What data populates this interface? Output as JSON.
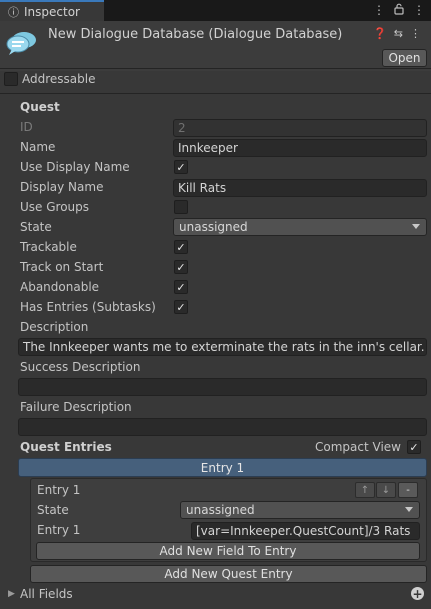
{
  "tab": {
    "icon": "info-icon",
    "label": "Inspector"
  },
  "header": {
    "title": "New Dialogue Database (Dialogue Database)",
    "open_label": "Open"
  },
  "addressable": {
    "label": "Addressable",
    "checked": false
  },
  "quest": {
    "heading": "Quest",
    "id": {
      "label": "ID",
      "value": "2"
    },
    "name": {
      "label": "Name",
      "value": "Innkeeper"
    },
    "use_display_name": {
      "label": "Use Display Name",
      "checked": true
    },
    "display_name": {
      "label": "Display Name",
      "value": "Kill Rats"
    },
    "use_groups": {
      "label": "Use Groups",
      "checked": false
    },
    "state": {
      "label": "State",
      "value": "unassigned"
    },
    "trackable": {
      "label": "Trackable",
      "checked": true
    },
    "track_on_start": {
      "label": "Track on Start",
      "checked": true
    },
    "abandonable": {
      "label": "Abandonable",
      "checked": true
    },
    "has_entries": {
      "label": "Has Entries (Subtasks)",
      "checked": true
    },
    "description": {
      "label": "Description",
      "value": "The Innkeeper wants me to exterminate the rats in the inn's cellar."
    },
    "success_description": {
      "label": "Success Description",
      "value": ""
    },
    "failure_description": {
      "label": "Failure Description",
      "value": ""
    }
  },
  "quest_entries": {
    "heading": "Quest Entries",
    "compact_view": {
      "label": "Compact View",
      "checked": true
    },
    "entry_bar": "Entry 1",
    "entry": {
      "title": "Entry 1",
      "up": "↑",
      "down": "↓",
      "remove": "-",
      "state": {
        "label": "State",
        "value": "unassigned"
      },
      "text": {
        "label": "Entry 1",
        "value": "[var=Innkeeper.QuestCount]/3 Rats"
      },
      "add_field_label": "Add New Field To Entry"
    },
    "add_entry_label": "Add New Quest Entry"
  },
  "all_fields": {
    "label": "All Fields"
  },
  "colors": {
    "accent": "#3a79bb",
    "entry_bar": "#46607c"
  }
}
